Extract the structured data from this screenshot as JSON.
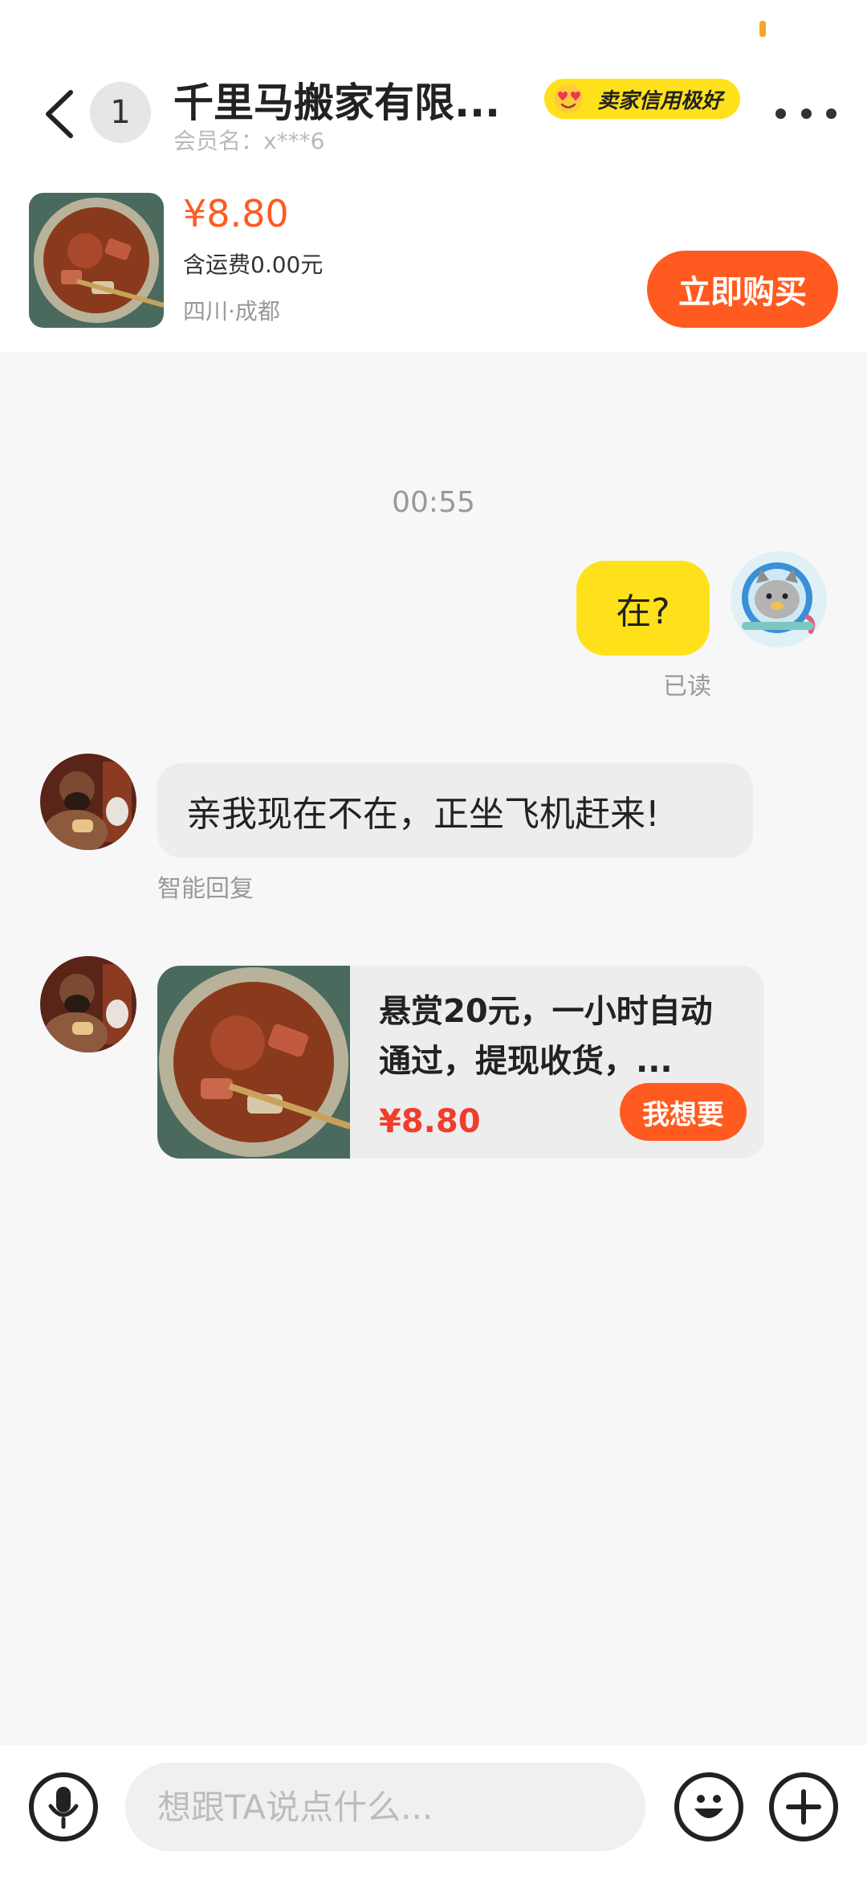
{
  "header": {
    "unread_count": "1",
    "seller_name": "千里马搬家有限...",
    "member_name": "会员名：x***6",
    "credit_badge": "卖家信用极好"
  },
  "product": {
    "price": "¥8.80",
    "shipping": "含运费0.00元",
    "location": "四川·成都",
    "buy_label": "立即购买"
  },
  "chat": {
    "timestamp": "00:55",
    "messages": [
      {
        "sender": "me",
        "text": "在?",
        "status": "已读"
      },
      {
        "sender": "seller",
        "text": "亲我现在不在，正坐飞机赶来!",
        "note": "智能回复"
      }
    ],
    "product_card": {
      "title": "悬赏20元，一小时自动通过，提现收货，...",
      "price": "¥8.80",
      "want_label": "我想要"
    }
  },
  "input": {
    "placeholder": "想跟TA说点什么..."
  },
  "colors": {
    "accent": "#ff5a1f",
    "bubble_mine": "#ffe11b",
    "price_red": "#f23c2c"
  }
}
